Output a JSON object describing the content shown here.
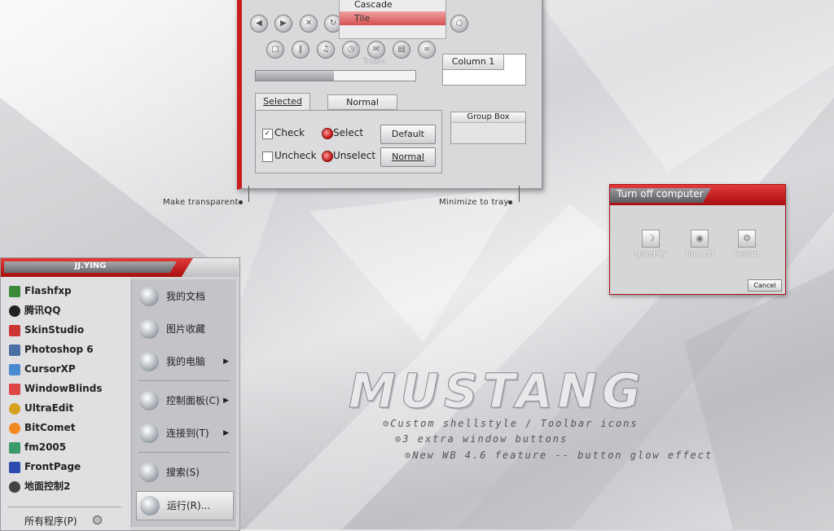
{
  "demo_window": {
    "menu_items": [
      "Cascade",
      "Tile"
    ],
    "faint_text": [
      "Tr",
      "Tropic"
    ],
    "list_column": "Column 1",
    "tabs": [
      "Selected",
      "Normal"
    ],
    "check_label": "Check",
    "uncheck_label": "Uncheck",
    "select_label": "Select",
    "unselect_label": "Unselect",
    "default_button": "Default",
    "normal_button": "Normal",
    "group_box": "Group Box",
    "progress": 0.49
  },
  "notes": {
    "make_transparent": "Make transparent",
    "minimize_to_tray": "Minimize to tray"
  },
  "turn_off": {
    "title": "Turn off computer",
    "stand_by": "Stand By",
    "turn_off": "Turn Off",
    "restart": "Restart",
    "cancel": "Cancel"
  },
  "start_menu": {
    "user": "JJ.YING",
    "programs": [
      "Flashfxp",
      "腾讯QQ",
      "SkinStudio",
      "Photoshop 6",
      "CursorXP",
      "WindowBlinds",
      "UltraEdit",
      "BitComet",
      "fm2005",
      "FrontPage",
      "地面控制2"
    ],
    "all_programs": "所有程序(P)",
    "places": [
      "我的文档",
      "图片收藏",
      "我的电脑",
      "控制面板(C)",
      "连接到(T)",
      "搜索(S)",
      "运行(R)..."
    ]
  },
  "branding": {
    "title": "MUSTANG",
    "features": [
      "Custom shellstyle / Toolbar icons",
      "3 extra window buttons",
      "New WB 4.6 feature -- button glow effect"
    ]
  }
}
